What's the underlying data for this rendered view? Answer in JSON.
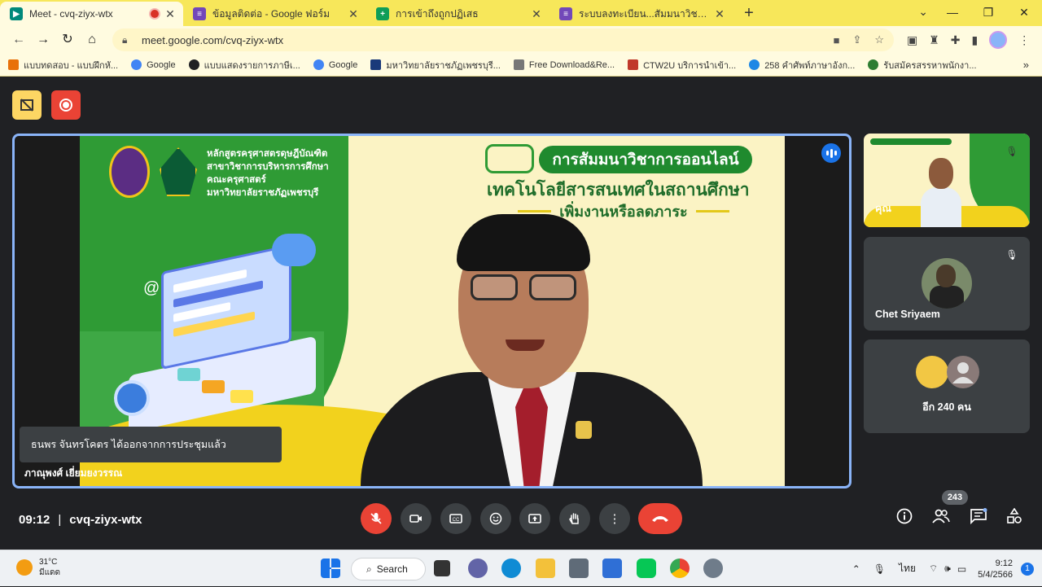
{
  "browser": {
    "tabs": [
      {
        "title": "Meet - cvq-ziyx-wtx",
        "active": true,
        "favicon_color": "#00897b",
        "recording": true
      },
      {
        "title": "ข้อมูลติดต่อ - Google ฟอร์ม",
        "active": false,
        "favicon_color": "#7248b9"
      },
      {
        "title": "การเข้าถึงถูกปฏิเสธ",
        "active": false,
        "favicon_color": "#0f9d58"
      },
      {
        "title": "ระบบลงทะเบียน...สัมมนาวิชาการออนไล",
        "active": false,
        "favicon_color": "#7248b9"
      }
    ],
    "new_tab": "+",
    "url": "meet.google.com/cvq-ziyx-wtx",
    "bookmarks": [
      {
        "label": "แบบทดสอบ - แบบฝึกหั...",
        "color": "#e8710a"
      },
      {
        "label": "Google",
        "color": "#4285f4"
      },
      {
        "label": "แบบแสดงรายการภาษีเ...",
        "color": "#202124"
      },
      {
        "label": "Google",
        "color": "#4285f4"
      },
      {
        "label": "มหาวิทยาลัยราชภัฏเพชรบุรี...",
        "color": "#1a3a7a"
      },
      {
        "label": "Free Download&Re...",
        "color": "#777777"
      },
      {
        "label": "CTW2U บริการนำเข้า...",
        "color": "#c0392b"
      },
      {
        "label": "258 คำศัพท์ภาษาอังก...",
        "color": "#1e88e5"
      },
      {
        "label": "รับสมัครสรรหาพนักงา...",
        "color": "#2e7d32"
      }
    ]
  },
  "meet": {
    "slide": {
      "institution_lines": [
        "หลักสูตรครุศาสตรดุษฎีบัณฑิต",
        "สาขาวิชาการบริหารการศึกษา",
        "คณะครุศาสตร์",
        "มหาวิทยาลัยราชภัฏเพชรบุรี"
      ],
      "title_pill": "การสัมมนาวิชาการออนไลน์",
      "title_line2": "เทคโนโลยีสารสนเทศในสถานศึกษา",
      "title_line3": "เพิ่มงานหรือลดภาระ"
    },
    "toast": "ธนพร จันทรโคตร ได้ออกจากการประชุมแล้ว",
    "main_speaker_name": "ภาณุพงศ์ เยี่ยมยงวรรณ",
    "side_tiles": [
      {
        "name": "คุณ"
      },
      {
        "name": "Chet Sriyaem"
      },
      {
        "name": "อีก 240 คน"
      }
    ],
    "time": "09:12",
    "meeting_code": "cvq-ziyx-wtx",
    "participants_count": "243",
    "accent": "#8ab4f8",
    "danger": "#ea4335"
  },
  "taskbar": {
    "temperature": "31°C",
    "weather_desc": "มีแดด",
    "search_label": "Search",
    "lang": "ไทย",
    "time": "9:12",
    "date": "5/4/2566",
    "notifications": "1"
  }
}
